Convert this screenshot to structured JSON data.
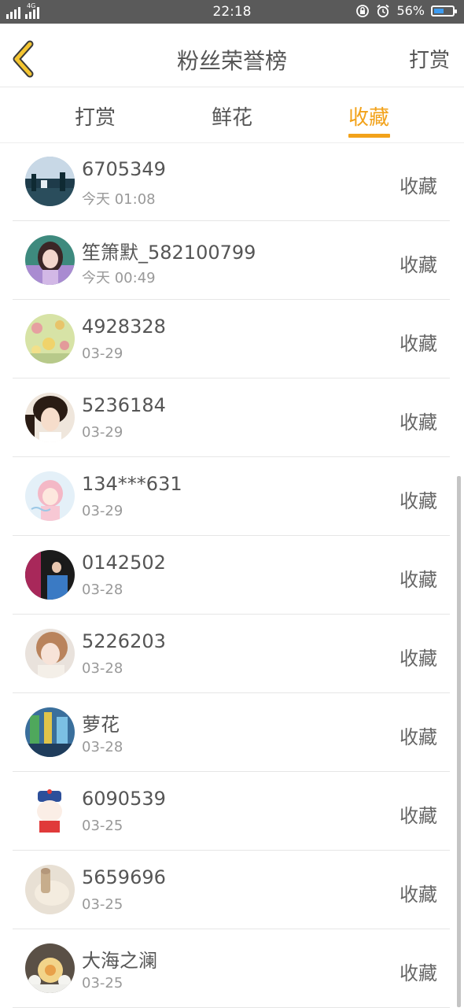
{
  "status_bar": {
    "time": "22:18",
    "network": "4G",
    "battery_percent": "56%",
    "battery_level": 0.56
  },
  "header": {
    "title": "粉丝荣誉榜",
    "action": "打赏",
    "back_icon": "chevron-left-icon",
    "accent_color": "#f2a21a"
  },
  "tabs": [
    {
      "label": "打赏",
      "active": false
    },
    {
      "label": "鲜花",
      "active": false
    },
    {
      "label": "收藏",
      "active": true
    }
  ],
  "fans": [
    {
      "name": "6705349",
      "date": "今天 01:08",
      "action": "收藏"
    },
    {
      "name": "笙箫默_582100799",
      "date": "今天 00:49",
      "action": "收藏"
    },
    {
      "name": "4928328",
      "date": "03-29",
      "action": "收藏"
    },
    {
      "name": "5236184",
      "date": "03-29",
      "action": "收藏"
    },
    {
      "name": "134***631",
      "date": "03-29",
      "action": "收藏"
    },
    {
      "name": "0142502",
      "date": "03-28",
      "action": "收藏"
    },
    {
      "name": "5226203",
      "date": "03-28",
      "action": "收藏"
    },
    {
      "name": "萝花",
      "date": "03-28",
      "action": "收藏"
    },
    {
      "name": "6090539",
      "date": "03-25",
      "action": "收藏"
    },
    {
      "name": "5659696",
      "date": "03-25",
      "action": "收藏"
    },
    {
      "name": "大海之澜",
      "date": "03-25",
      "action": "收藏"
    }
  ]
}
